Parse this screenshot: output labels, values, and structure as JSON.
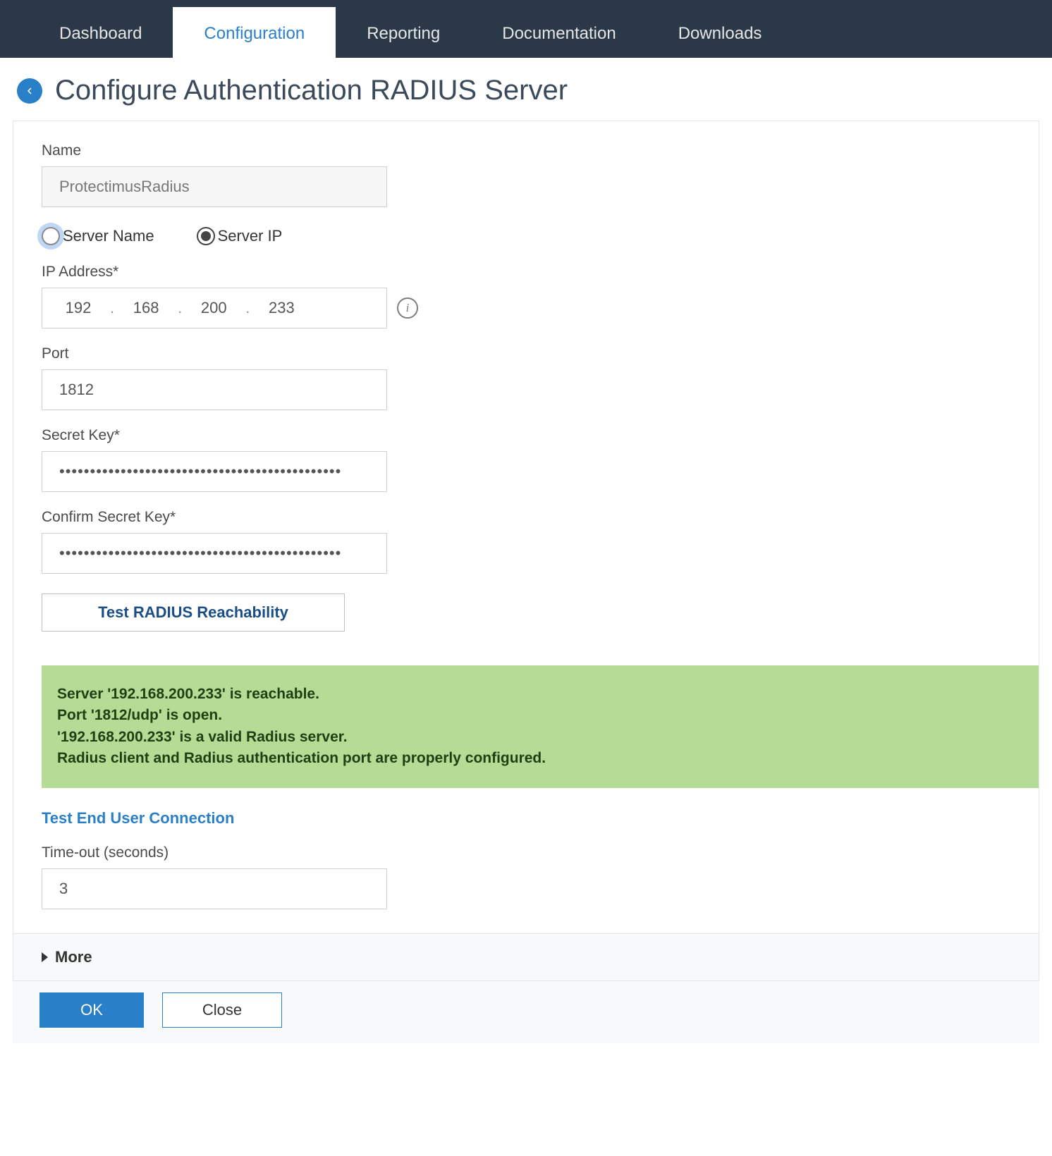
{
  "nav": {
    "tabs": [
      {
        "label": "Dashboard",
        "active": false
      },
      {
        "label": "Configuration",
        "active": true
      },
      {
        "label": "Reporting",
        "active": false
      },
      {
        "label": "Documentation",
        "active": false
      },
      {
        "label": "Downloads",
        "active": false
      }
    ]
  },
  "page": {
    "title": "Configure Authentication RADIUS Server"
  },
  "form": {
    "name_label": "Name",
    "name_value": "ProtectimusRadius",
    "server_name_label": "Server Name",
    "server_ip_label": "Server IP",
    "ip_label": "IP Address*",
    "ip_octets": [
      "192",
      "168",
      "200",
      "233"
    ],
    "port_label": "Port",
    "port_value": "1812",
    "secret_label": "Secret Key*",
    "secret_value": "••••••••••••••••••••••••••••••••••••••••••••••",
    "confirm_label": "Confirm Secret Key*",
    "confirm_value": "••••••••••••••••••••••••••••••••••••••••••••••",
    "test_reach_label": "Test RADIUS Reachability",
    "result": {
      "line1": "Server '192.168.200.233' is reachable.",
      "line2": "Port '1812/udp' is open.",
      "line3": "'192.168.200.233' is a valid Radius server.",
      "line4": "Radius client and Radius authentication port are properly configured."
    },
    "test_user_label": "Test End User Connection",
    "timeout_label": "Time-out (seconds)",
    "timeout_value": "3",
    "more_label": "More"
  },
  "footer": {
    "ok": "OK",
    "close": "Close"
  }
}
